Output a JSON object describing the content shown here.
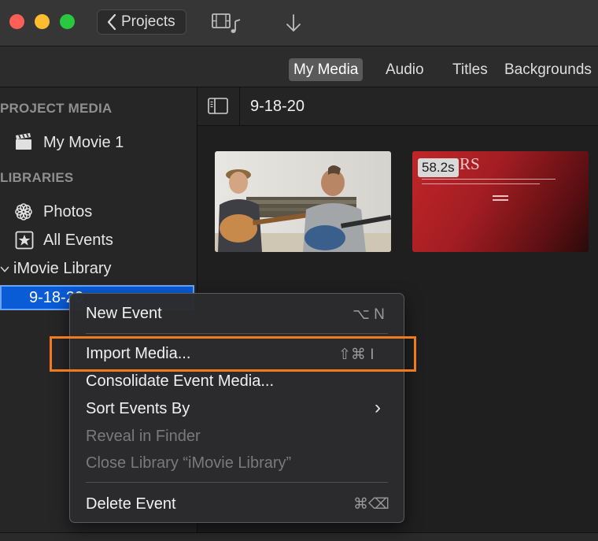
{
  "toolbar": {
    "projects_label": "Projects",
    "media_icon": "film-music-icon",
    "import_icon": "download-arrow-icon"
  },
  "tabs": [
    {
      "label": "My Media",
      "active": true
    },
    {
      "label": "Audio",
      "active": false
    },
    {
      "label": "Titles",
      "active": false
    },
    {
      "label": "Backgrounds",
      "active": false
    }
  ],
  "sidebar": {
    "project_media_heading": "PROJECT MEDIA",
    "movie_label": "My Movie 1",
    "libraries_heading": "LIBRARIES",
    "photos_label": "Photos",
    "all_events_label": "All Events",
    "library_label": "iMovie Library",
    "selected_event_label": "9-18-20"
  },
  "browser": {
    "event_title": "9-18-20",
    "clips": [
      {
        "type": "video",
        "description_icon": "musicians-thumbnail"
      },
      {
        "type": "title-card",
        "duration": "58.2s",
        "card_text": "RS"
      }
    ]
  },
  "context_menu": {
    "items": [
      {
        "label": "New Event",
        "shortcut": "⌥ N",
        "enabled": true
      },
      {
        "label": "Import Media...",
        "shortcut": "⇧⌘ I",
        "enabled": true
      },
      {
        "label": "Consolidate Event Media...",
        "shortcut": "",
        "enabled": true
      },
      {
        "label": "Sort Events By",
        "shortcut": "›",
        "enabled": true
      },
      {
        "label": "Reveal in Finder",
        "shortcut": "",
        "enabled": false
      },
      {
        "label": "Close Library “iMovie Library”",
        "shortcut": "",
        "enabled": false
      },
      {
        "label": "Delete Event",
        "shortcut": "⌘⌫",
        "enabled": true
      }
    ]
  },
  "colors": {
    "selection_blue": "#0a5bd6",
    "highlight_orange": "#f07a1e",
    "active_tab": "#5a5a5a"
  }
}
